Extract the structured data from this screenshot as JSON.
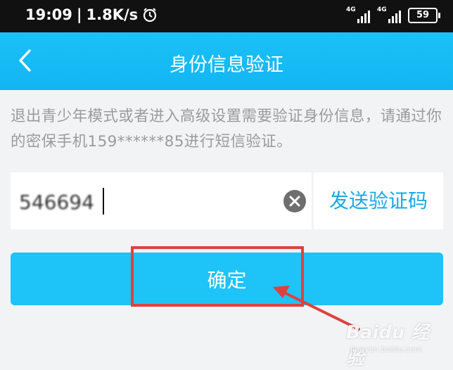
{
  "status_bar": {
    "time": "19:09",
    "separator": "|",
    "speed": "1.8K/s",
    "signal1_label": "4G",
    "signal2_label": "4G",
    "battery": "59"
  },
  "header": {
    "title": "身份信息验证",
    "back_icon": "chevron-left-icon"
  },
  "description": "退出青少年模式或者进入高级设置需要验证身份信息，请通过你的密保手机159******85进行短信验证。",
  "verification": {
    "code_value": "546694",
    "clear_icon": "clear-circle-icon",
    "send_code_label": "发送验证码"
  },
  "confirm_label": "确定",
  "annotation": {
    "highlight_color": "#e0413d"
  },
  "watermark": {
    "brand": "Baidu 经验",
    "url": "jingyan.baidu.com"
  },
  "colors": {
    "header": "#12b5f2",
    "button": "#1ec3f7",
    "link": "#19a8e6",
    "background": "#f2f3f5"
  }
}
